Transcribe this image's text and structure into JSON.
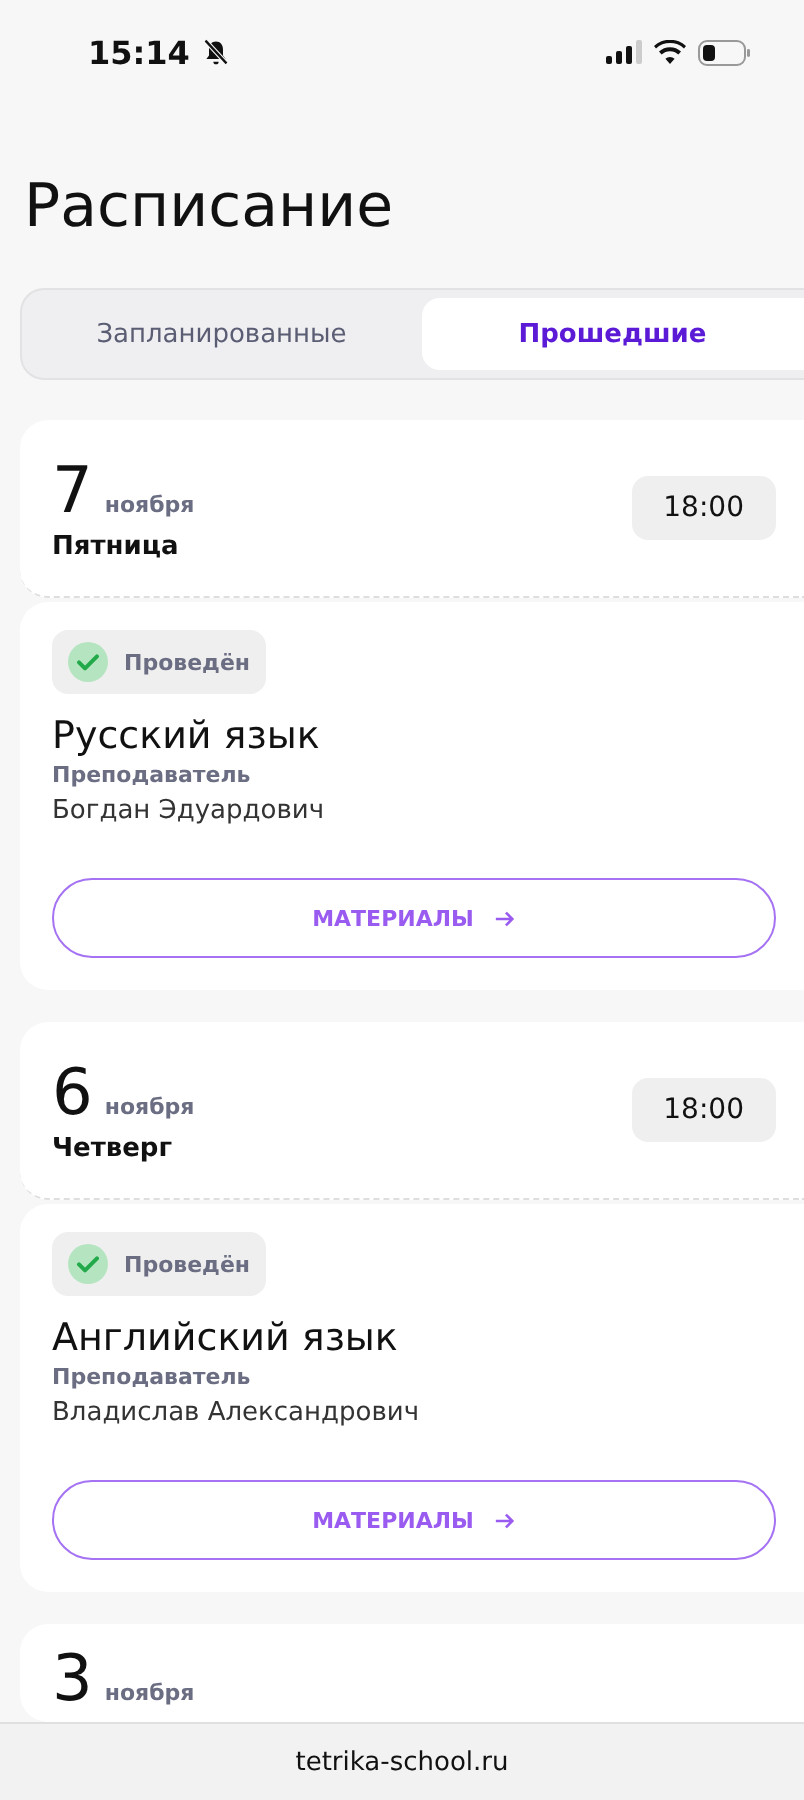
{
  "status_bar": {
    "time": "15:14",
    "silent": true
  },
  "title": "Расписание",
  "tabs": [
    {
      "label": "Запланированные",
      "selected": false
    },
    {
      "label": "Прошедшие",
      "selected": true
    }
  ],
  "lessons": [
    {
      "day": "7",
      "month": "ноября",
      "weekday": "Пятница",
      "time": "18:00",
      "status": "Проведён",
      "subject": "Русский язык",
      "teacher_label": "Преподаватель",
      "teacher": "Богдан Эдуардович",
      "button": "МАТЕРИАЛЫ"
    },
    {
      "day": "6",
      "month": "ноября",
      "weekday": "Четверг",
      "time": "18:00",
      "status": "Проведён",
      "subject": "Английский язык",
      "teacher_label": "Преподаватель",
      "teacher": "Владислав Александрович",
      "button": "МАТЕРИАЛЫ"
    },
    {
      "day": "3",
      "month": "ноября"
    }
  ],
  "url_bar": {
    "address": "tetrika-school.ru"
  }
}
